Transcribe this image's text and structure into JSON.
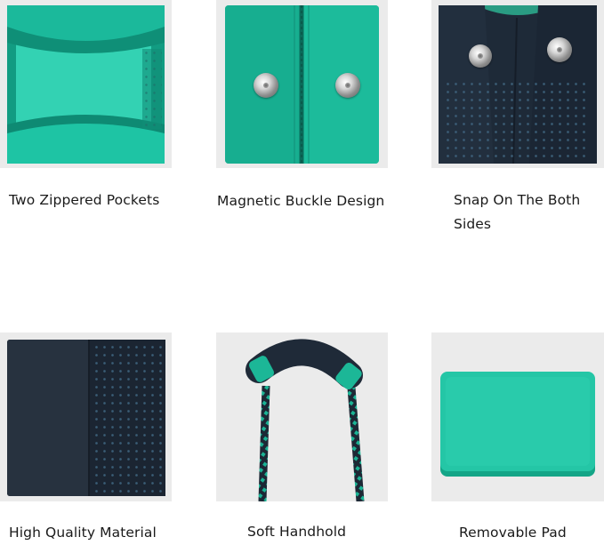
{
  "features": [
    {
      "caption": "Two Zippered Pockets",
      "image": "zippered-pockets-photo"
    },
    {
      "caption": "Magnetic Buckle Design",
      "image": "magnetic-buckle-photo"
    },
    {
      "caption": "Snap On The Both Sides",
      "image": "snap-sides-photo"
    },
    {
      "caption": "High Quality Material",
      "image": "neoprene-material-photo"
    },
    {
      "caption": "Soft Handhold",
      "image": "handle-photo"
    },
    {
      "caption": "Removable Pad",
      "image": "removable-pad-photo"
    }
  ],
  "colors": {
    "teal": "#17b497",
    "navy": "#1f2a38",
    "tile_bg": "#ebebeb"
  }
}
